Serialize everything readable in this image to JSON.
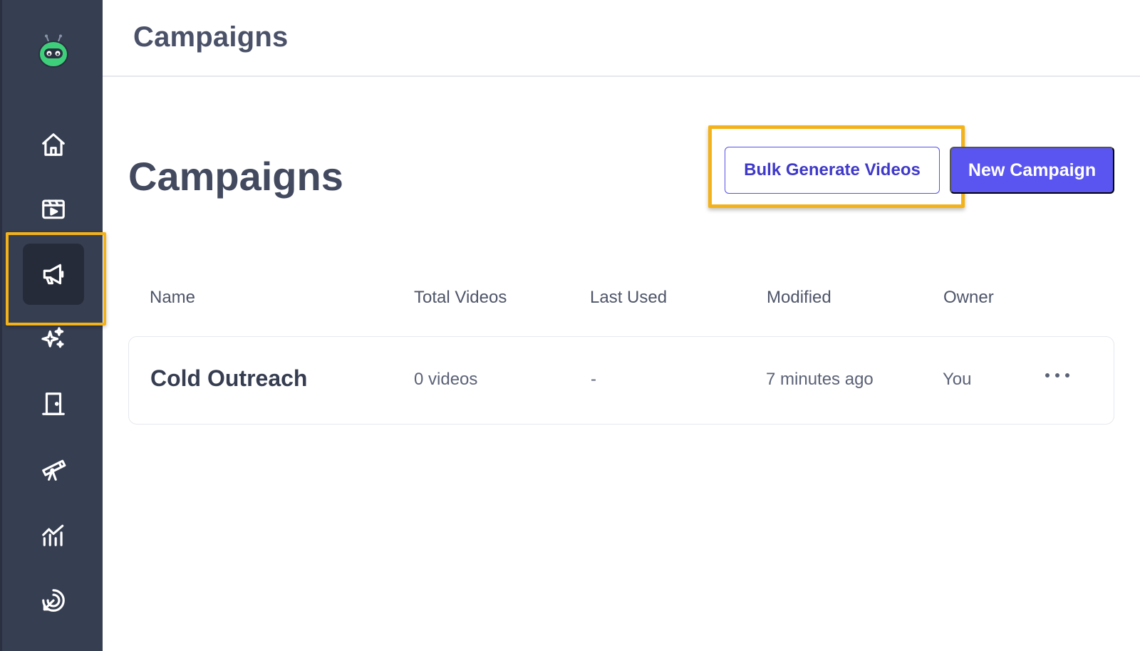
{
  "header": {
    "title": "Campaigns"
  },
  "page": {
    "title": "Campaigns"
  },
  "actions": {
    "bulk_generate_label": "Bulk Generate Videos",
    "new_campaign_label": "New Campaign"
  },
  "sidebar": {
    "items": [
      {
        "icon": "home-icon",
        "active": false
      },
      {
        "icon": "video-clapper-icon",
        "active": false
      },
      {
        "icon": "megaphone-icon",
        "active": true
      },
      {
        "icon": "sparkles-icon",
        "active": false
      },
      {
        "icon": "door-icon",
        "active": false
      },
      {
        "icon": "telescope-icon",
        "active": false
      },
      {
        "icon": "analytics-chart-icon",
        "active": false
      },
      {
        "icon": "target-pointer-icon",
        "active": false
      }
    ]
  },
  "table": {
    "columns": [
      "Name",
      "Total Videos",
      "Last Used",
      "Modified",
      "Owner"
    ],
    "rows": [
      {
        "name": "Cold Outreach",
        "total_videos": "0 videos",
        "last_used": "-",
        "modified": "7 minutes ago",
        "owner": "You"
      }
    ]
  },
  "colors": {
    "sidebar_bg": "#363e51",
    "accent": "#5a55f0",
    "highlight": "#f3b21a",
    "logo_green": "#3ecf7a"
  }
}
